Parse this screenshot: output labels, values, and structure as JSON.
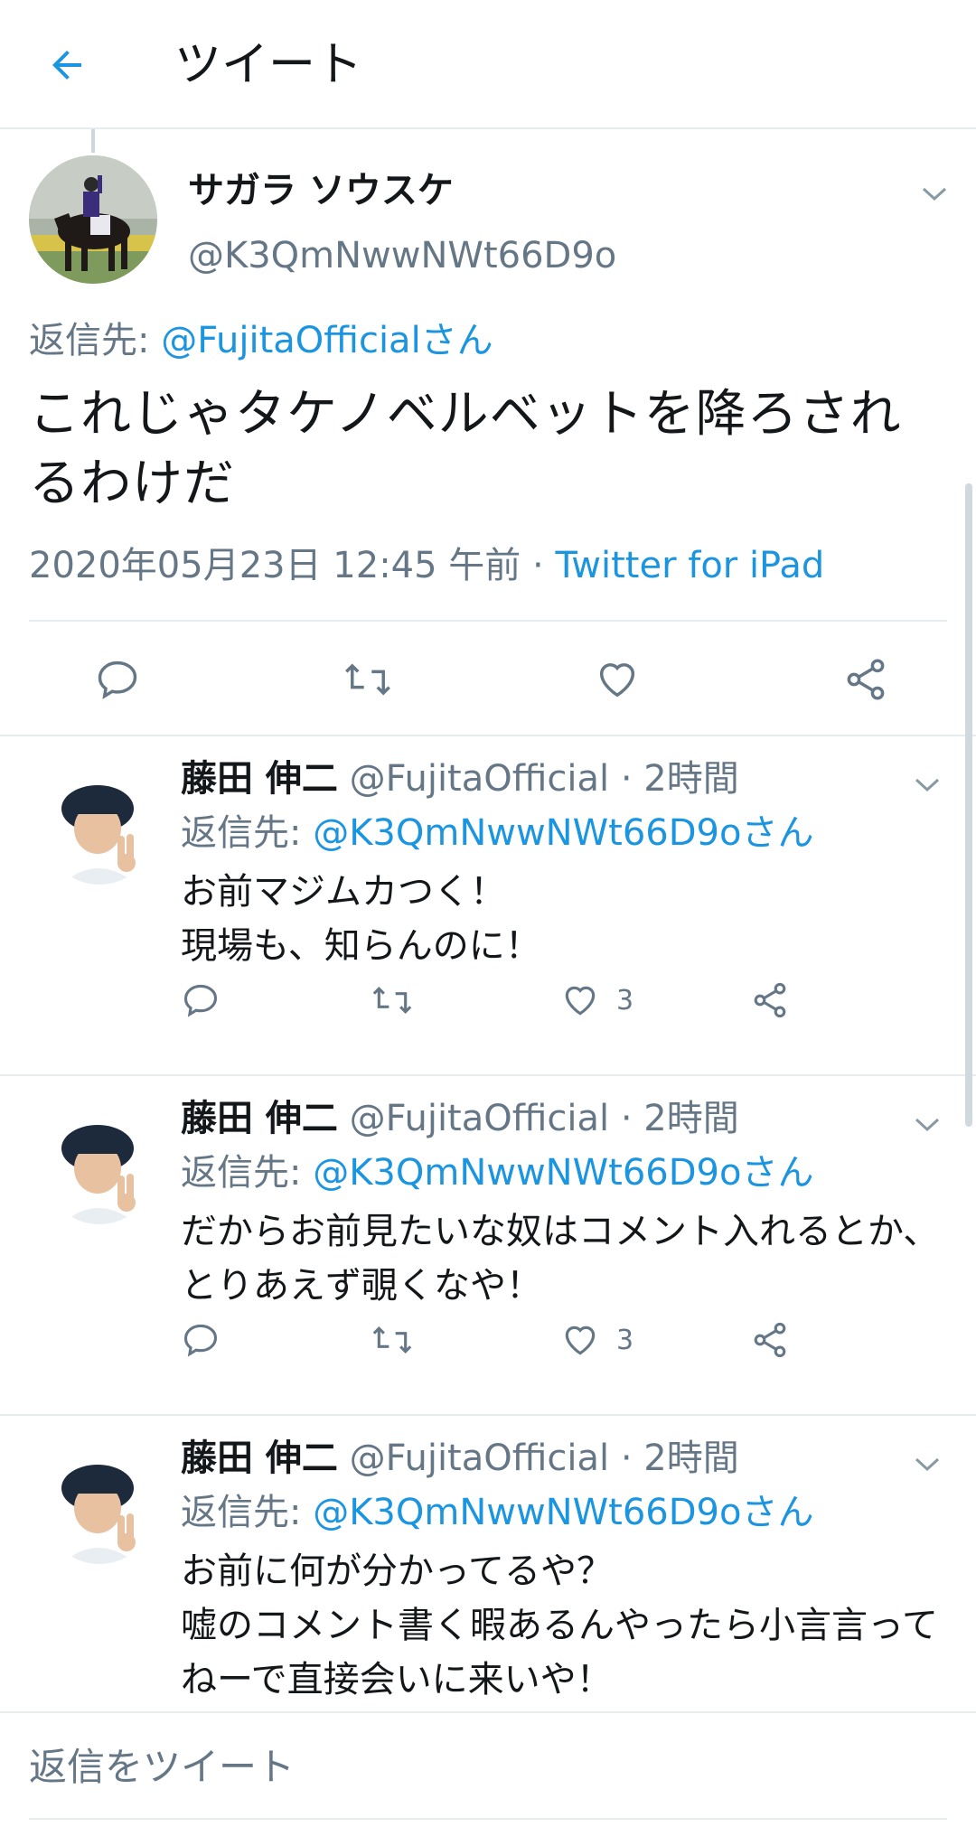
{
  "header": {
    "title": "ツイート"
  },
  "main_tweet": {
    "name": "サガラ ソウスケ",
    "handle": "@K3QmNwwNWt66D9o",
    "reply_prefix": "返信先: ",
    "reply_target": "@FujitaOfficialさん",
    "text": "これじゃタケノベルベットを降ろされるわけだ",
    "timestamp": "2020年05月23日 12:45 午前 · ",
    "source": "Twitter for iPad"
  },
  "replies": [
    {
      "name": "藤田 伸二",
      "handle": " @FujitaOfficial · 2時間",
      "reply_prefix": "返信先: ",
      "reply_target": "@K3QmNwwNWt66D9oさん",
      "text": "お前マジムカつく！\n現場も、知らんのに！",
      "likes": "3"
    },
    {
      "name": "藤田 伸二",
      "handle": " @FujitaOfficial · 2時間",
      "reply_prefix": "返信先: ",
      "reply_target": "@K3QmNwwNWt66D9oさん",
      "text": "だからお前見たいな奴はコメント入れるとか、とりあえず覗くなや！",
      "likes": "3"
    },
    {
      "name": "藤田 伸二",
      "handle": " @FujitaOfficial · 2時間",
      "reply_prefix": "返信先: ",
      "reply_target": "@K3QmNwwNWt66D9oさん",
      "text": "お前に何が分かってるや？\n嘘のコメント書く暇あるんやったら小言言ってねーで直接会いに来いや！"
    }
  ],
  "compose": {
    "placeholder": "返信をツイート"
  },
  "icons": {
    "back": "arrow-left-icon",
    "reply": "reply-icon",
    "retweet": "retweet-icon",
    "like": "heart-icon",
    "share": "share-icon",
    "caret": "chevron-down-icon"
  },
  "colors": {
    "accent": "#1b95e0",
    "text": "#14171a",
    "muted": "#657786",
    "divider": "#e6ecf0"
  }
}
